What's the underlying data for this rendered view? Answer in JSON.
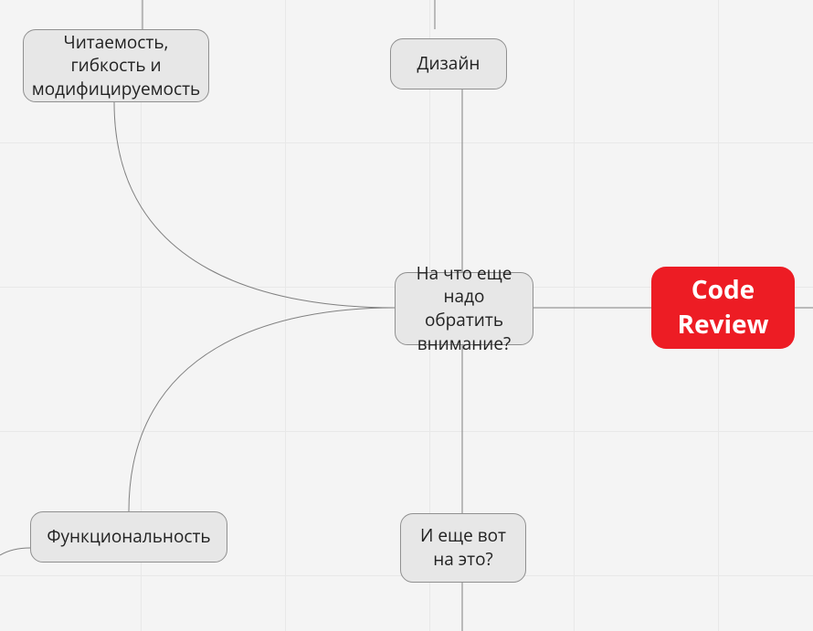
{
  "nodes": {
    "root": {
      "label": "Code Review"
    },
    "center": {
      "label": "На что еще надо обратить внимание?"
    },
    "readability": {
      "label": "Читаемость, гибкость и модифицируемость"
    },
    "design": {
      "label": "Дизайн"
    },
    "functionality": {
      "label": "Функциональность"
    },
    "more": {
      "label": "И еще вот на это?"
    }
  },
  "chart_data": {
    "type": "mindmap",
    "root": "Code Review",
    "children": [
      {
        "label": "На что еще надо обратить внимание?",
        "children": [
          {
            "label": "Читаемость, гибкость и модифицируемость"
          },
          {
            "label": "Дизайн"
          },
          {
            "label": "Функциональность"
          },
          {
            "label": "И еще вот на это?"
          }
        ]
      }
    ]
  }
}
